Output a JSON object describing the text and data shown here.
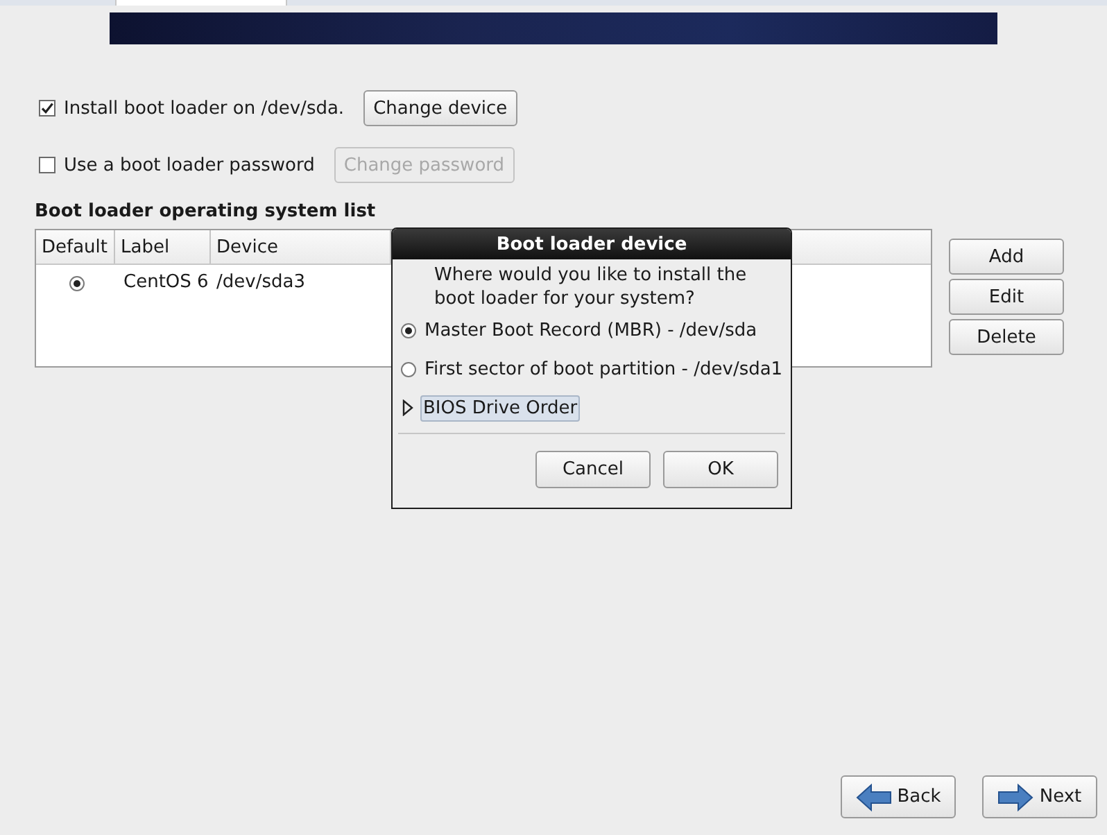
{
  "options": [
    {
      "kind": "checkbox",
      "label": "Install boot loader on /dev/sda.",
      "checked": true,
      "button": {
        "label": "Change device",
        "disabled": false
      }
    },
    {
      "kind": "checkbox",
      "label": "Use a boot loader password",
      "checked": false,
      "button": {
        "label": "Change password",
        "disabled": true
      }
    }
  ],
  "os_list": {
    "title": "Boot loader operating system list",
    "columns": [
      "Default",
      "Label",
      "Device"
    ],
    "rows": [
      {
        "selected": true,
        "label": "CentOS 6",
        "device": "/dev/sda3"
      }
    ],
    "buttons": [
      "Add",
      "Edit",
      "Delete"
    ]
  },
  "dialog": {
    "title": "Boot loader device",
    "prompt": "Where would you like to install the boot loader for your system?",
    "choices": [
      {
        "label": "Master Boot Record (MBR) - /dev/sda",
        "selected": true
      },
      {
        "label": "First sector of boot partition - /dev/sda1",
        "selected": false
      }
    ],
    "expander": {
      "label": "BIOS Drive Order",
      "expanded": false
    },
    "buttons": [
      "Cancel",
      "OK"
    ]
  },
  "nav": [
    {
      "kind": "back",
      "label": "Back"
    },
    {
      "kind": "next",
      "label": "Next"
    }
  ]
}
